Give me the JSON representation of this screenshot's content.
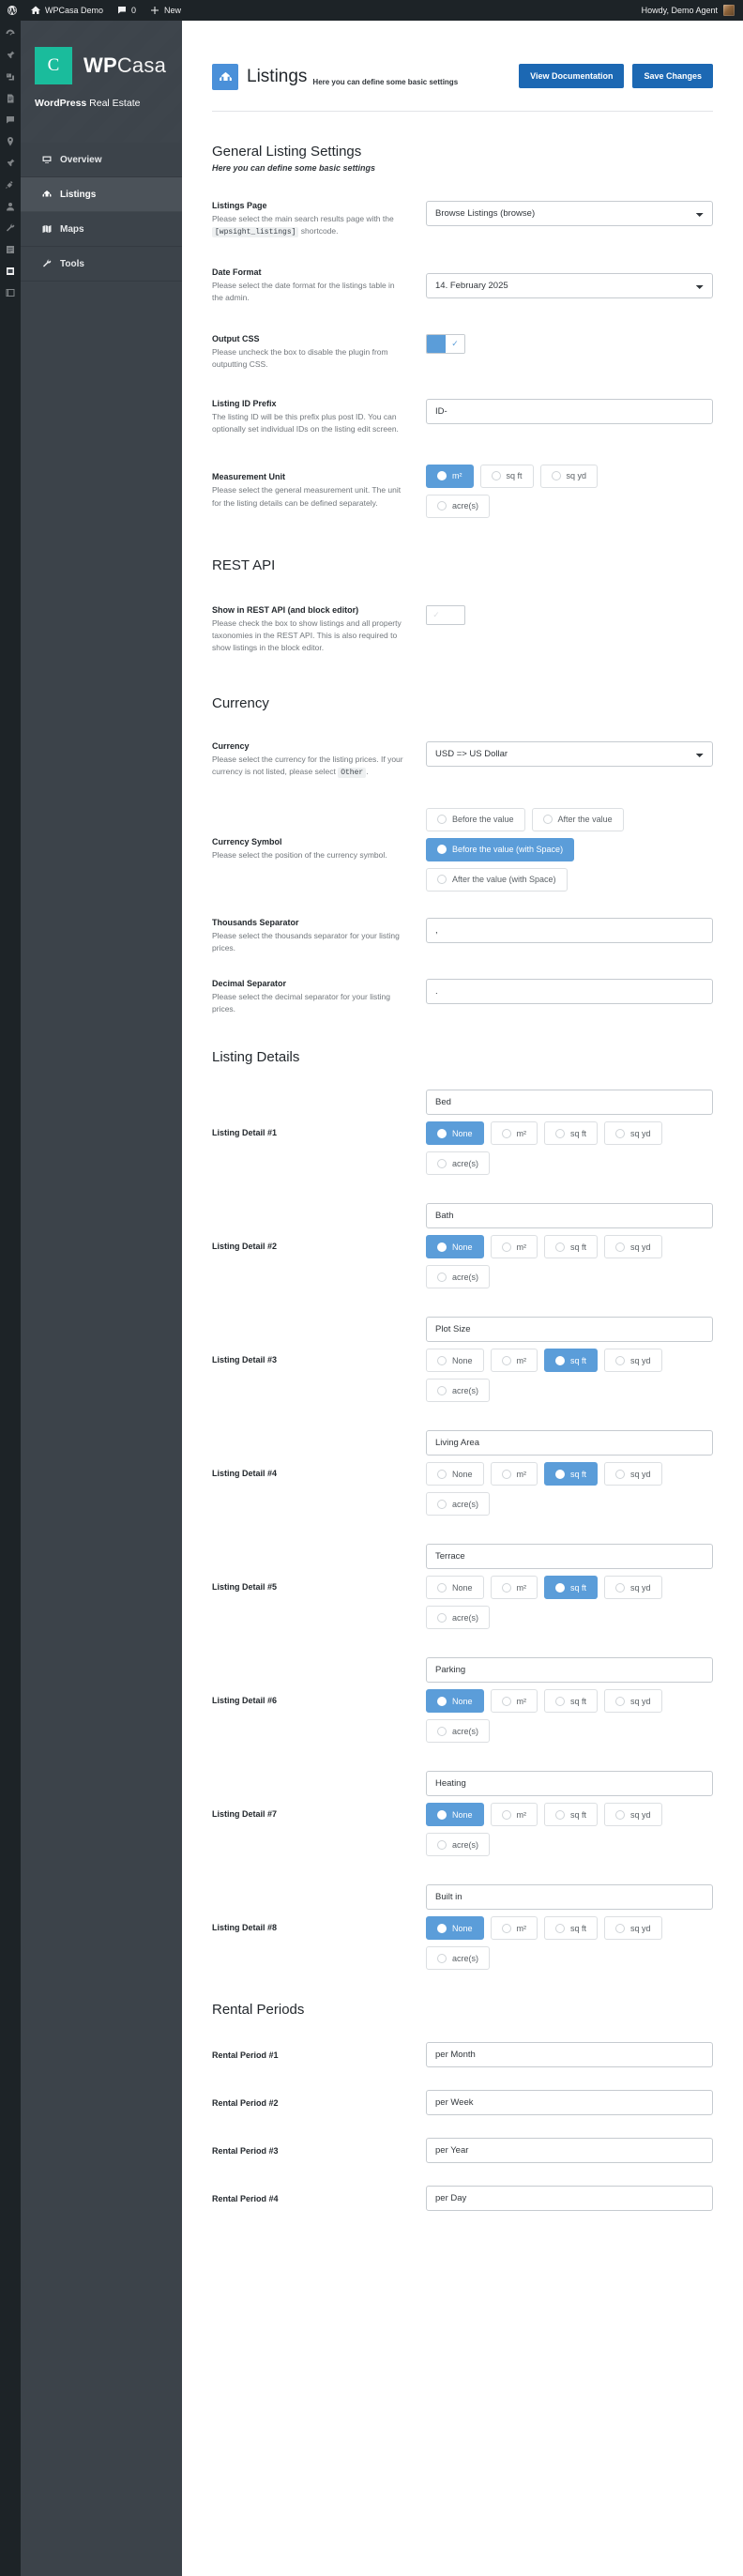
{
  "adminbar": {
    "wp_logo": "wordpress-logo-icon",
    "site_name": "WPCasa Demo",
    "comments_count": "0",
    "new_label": "New",
    "howdy": "Howdy, Demo Agent"
  },
  "sidebar": {
    "brand": {
      "mark": "C",
      "name_bold": "WP",
      "name_light": "Casa",
      "tagline_bold": "WordPress",
      "tagline_rest": " Real Estate"
    },
    "items": [
      {
        "label": "Overview",
        "icon": "screen-icon",
        "active": false
      },
      {
        "label": "Listings",
        "icon": "listings-icon",
        "active": true
      },
      {
        "label": "Maps",
        "icon": "map-icon",
        "active": false
      },
      {
        "label": "Tools",
        "icon": "wrench-icon",
        "active": false
      }
    ]
  },
  "header": {
    "icon": "listings-icon",
    "title": "Listings",
    "subtitle": "Here you can define some basic settings",
    "view_documentation": "View Documentation",
    "save_changes": "Save Changes",
    "accent": "#1c68b3"
  },
  "general": {
    "title": "General Listing Settings",
    "description": "Here you can define some basic settings",
    "listings_page": {
      "label": "Listings Page",
      "hint_a": "Please select the main search results page with the",
      "code": "[wpsight_listings]",
      "hint_b": "shortcode.",
      "value": "Browse Listings (browse)"
    },
    "date_format": {
      "label": "Date Format",
      "hint": "Please select the date format for the listings table in the admin.",
      "value": "14. February 2025"
    },
    "output_css": {
      "label": "Output CSS",
      "hint": "Please uncheck the box to disable the plugin from outputting CSS.",
      "checked": true,
      "check_glyph": "✓"
    },
    "listing_id_prefix": {
      "label": "Listing ID Prefix",
      "hint": "The listing ID will be this prefix plus post ID. You can optionally set individual IDs on the listing edit screen.",
      "value": "ID-"
    },
    "measurement_unit": {
      "label": "Measurement Unit",
      "hint": "Please select the general measurement unit. The unit for the listing details can be defined separately.",
      "options": [
        "m²",
        "sq ft",
        "sq yd",
        "acre(s)"
      ],
      "selected": "m²"
    }
  },
  "rest_api": {
    "title": "REST API",
    "show": {
      "label": "Show in REST API (and block editor)",
      "hint": "Please check the box to show listings and all property taxonomies in the REST API. This is also required to show listings in the block editor.",
      "checked": false,
      "check_glyph": "✓"
    }
  },
  "currency": {
    "title": "Currency",
    "currency": {
      "label": "Currency",
      "hint_a": "Please select the currency for the listing prices. If your currency is not listed, please select",
      "code": "Other",
      "hint_b": ".",
      "value": "USD => US Dollar"
    },
    "symbol": {
      "label": "Currency Symbol",
      "hint": "Please select the position of the currency symbol.",
      "options": [
        "Before the value",
        "After the value",
        "Before the value (with Space)",
        "After the value (with Space)"
      ],
      "selected": "Before the value (with Space)"
    },
    "thousands": {
      "label": "Thousands Separator",
      "hint": "Please select the thousands separator for your listing prices.",
      "value": ","
    },
    "decimal": {
      "label": "Decimal Separator",
      "hint": "Please select the decimal separator for your listing prices.",
      "value": "."
    }
  },
  "listing_details": {
    "title": "Listing Details",
    "unit_options": [
      "None",
      "m²",
      "sq ft",
      "sq yd",
      "acre(s)"
    ],
    "rows": [
      {
        "label": "Listing Detail #1",
        "value": "Bed",
        "selected": "None"
      },
      {
        "label": "Listing Detail #2",
        "value": "Bath",
        "selected": "None"
      },
      {
        "label": "Listing Detail #3",
        "value": "Plot Size",
        "selected": "sq ft"
      },
      {
        "label": "Listing Detail #4",
        "value": "Living Area",
        "selected": "sq ft"
      },
      {
        "label": "Listing Detail #5",
        "value": "Terrace",
        "selected": "sq ft"
      },
      {
        "label": "Listing Detail #6",
        "value": "Parking",
        "selected": "None"
      },
      {
        "label": "Listing Detail #7",
        "value": "Heating",
        "selected": "None"
      },
      {
        "label": "Listing Detail #8",
        "value": "Built in",
        "selected": "None"
      }
    ]
  },
  "rental_periods": {
    "title": "Rental Periods",
    "rows": [
      {
        "label": "Rental Period #1",
        "value": "per Month"
      },
      {
        "label": "Rental Period #2",
        "value": "per Week"
      },
      {
        "label": "Rental Period #3",
        "value": "per Year"
      },
      {
        "label": "Rental Period #4",
        "value": "per Day"
      }
    ]
  }
}
